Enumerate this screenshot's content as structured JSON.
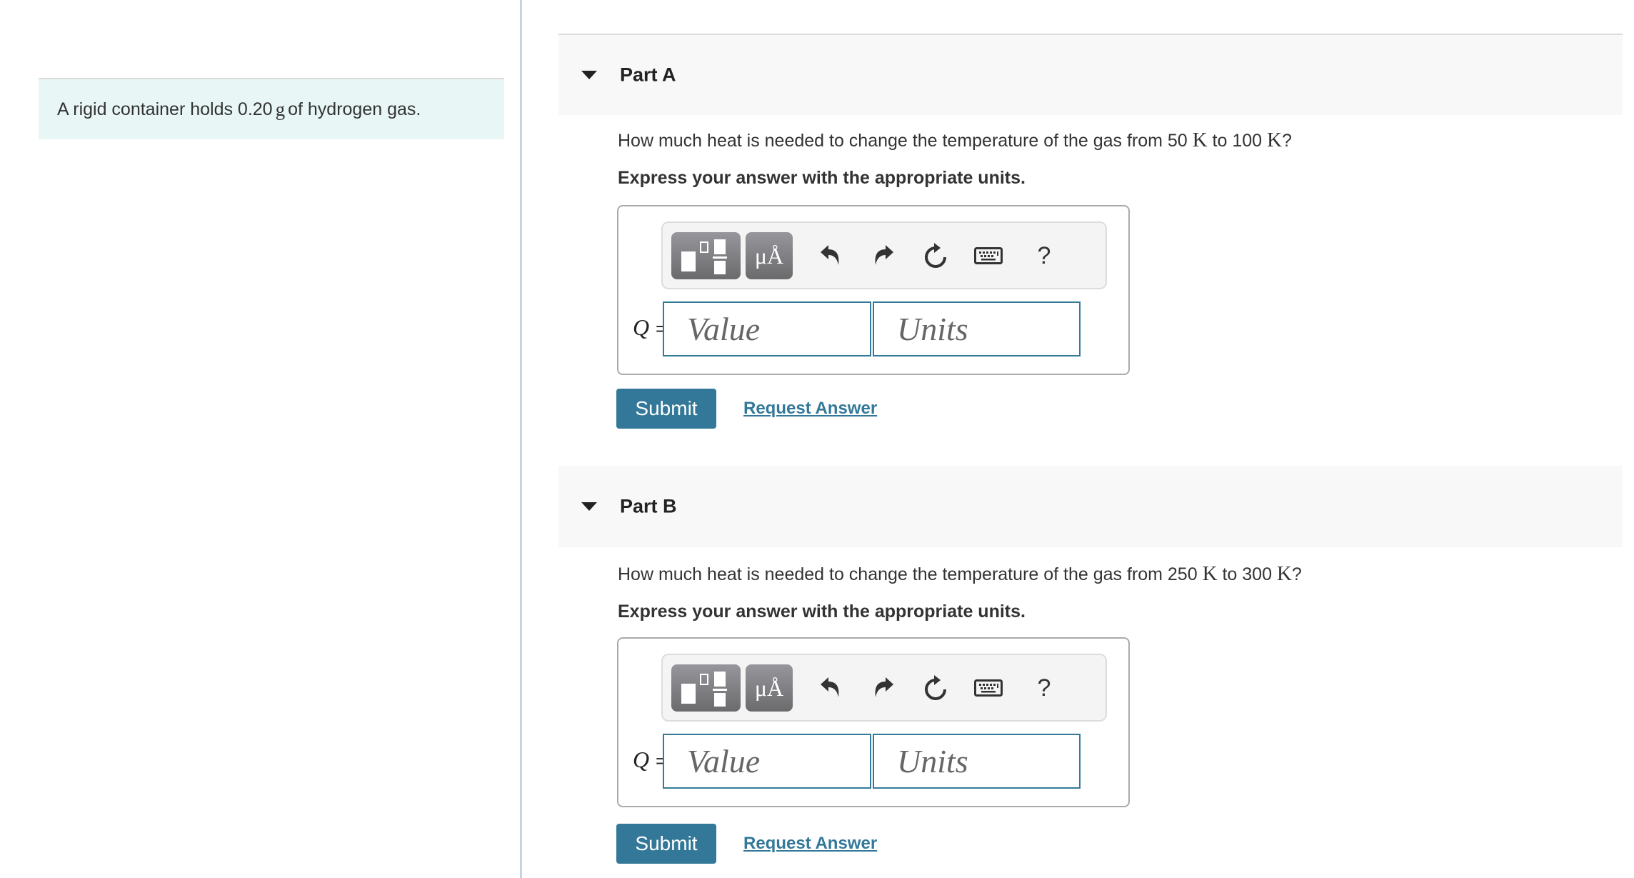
{
  "intro": {
    "text_before": "A rigid container holds 0.20 ",
    "unit": "g",
    "text_after": " of hydrogen gas."
  },
  "parts": [
    {
      "title": "Part A",
      "question": {
        "pre": "How much heat is needed to change the temperature of the gas from 50 ",
        "unit1": "K",
        "mid": " to 100 ",
        "unit2": "K",
        "post": "?"
      },
      "instruction": "Express your answer with the appropriate units.",
      "toolbar": {
        "templates_icon": "templates-icon",
        "symbols_label": "μÅ",
        "undo_icon": "undo-icon",
        "redo_icon": "redo-icon",
        "reset_icon": "reset-icon",
        "keyboard_icon": "keyboard-icon",
        "help_label": "?"
      },
      "variable": "Q",
      "equals": "=",
      "value_placeholder": "Value",
      "units_placeholder": "Units",
      "submit_label": "Submit",
      "request_label": "Request Answer"
    },
    {
      "title": "Part B",
      "question": {
        "pre": "How much heat is needed to change the temperature of the gas from 250 ",
        "unit1": "K",
        "mid": " to 300 ",
        "unit2": "K",
        "post": "?"
      },
      "instruction": "Express your answer with the appropriate units.",
      "toolbar": {
        "templates_icon": "templates-icon",
        "symbols_label": "μÅ",
        "undo_icon": "undo-icon",
        "redo_icon": "redo-icon",
        "reset_icon": "reset-icon",
        "keyboard_icon": "keyboard-icon",
        "help_label": "?"
      },
      "variable": "Q",
      "equals": "=",
      "value_placeholder": "Value",
      "units_placeholder": "Units",
      "submit_label": "Submit",
      "request_label": "Request Answer"
    }
  ],
  "colors": {
    "accent": "#337899",
    "intro_bg": "#e8f6f6",
    "header_bg": "#f8f8f8",
    "divider": "#c5d3e2"
  }
}
